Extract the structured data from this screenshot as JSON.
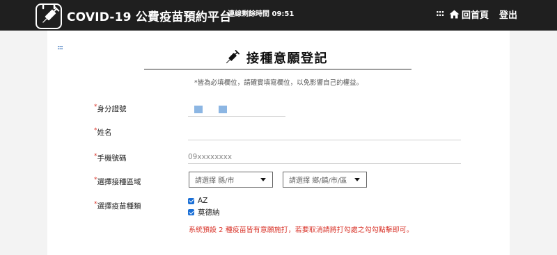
{
  "header": {
    "brand": "COVID-19 公費疫苗預約平台",
    "session_text": "連線剩餘時間 09:51",
    "menu_dots": ":::",
    "home_label": "回首頁",
    "logout_label": "登出"
  },
  "page": {
    "side_dots": ":::",
    "title": "接種意願登記",
    "note": "*皆為必填欄位，請確實填寫欄位，以免影響自己的權益。"
  },
  "form": {
    "required_mark": "*",
    "id_label": "身分證號",
    "name_label": "姓名",
    "name_value": "",
    "phone_label": "手機號碼",
    "phone_placeholder": "09xxxxxxxx",
    "region_label": "選擇接種區域",
    "city_placeholder": "請選擇 縣/市",
    "district_placeholder": "請選擇 鄉/鎮/市/區",
    "vaccine_label": "選擇疫苗種類",
    "vaccines": [
      {
        "label": "AZ",
        "checked": true
      },
      {
        "label": "莫德納",
        "checked": true
      }
    ],
    "vaccine_note": "系統預設 2 種疫苗皆有意願施打，若要取消請將打勾處之勾勾點擊即可。"
  },
  "colors": {
    "topbar": "#1f1f1f",
    "accent_blue": "#1a6fd6",
    "required_red": "#d9352b",
    "masked_id": "#8cb6e3"
  },
  "icons": {
    "logo": "syringe-calendar-icon",
    "title": "syringe-icon",
    "home": "home-icon"
  }
}
